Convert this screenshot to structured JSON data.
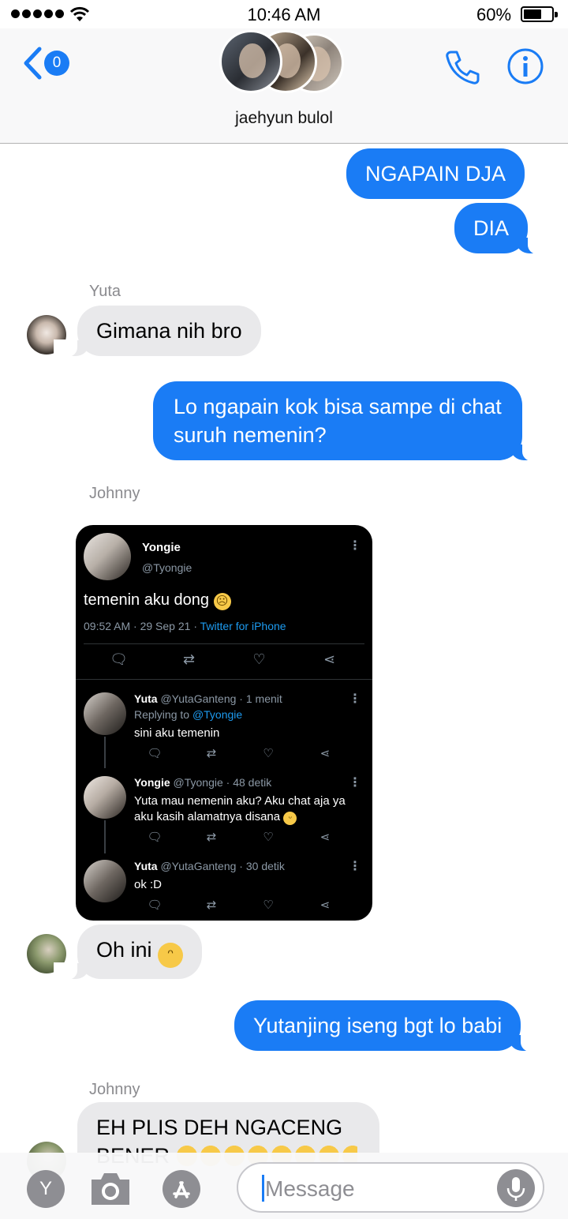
{
  "status_bar": {
    "time": "10:46 AM",
    "battery": "60%"
  },
  "nav": {
    "back_badge": "0",
    "title": "jaehyun bulol"
  },
  "messages": {
    "out1": "NGAPAIN DJA",
    "out2": "DIA",
    "yuta_sender": "Yuta",
    "yuta_msg": "Gimana nih bro",
    "out3_line1": "Lo ngapain kok bisa sampe di chat",
    "out3_line2": "suruh nemenin?",
    "johnny_sender": "Johnny",
    "johnny_msg": "Oh ini",
    "out4": "Yutanjing iseng bgt lo babi",
    "johnny_sender2": "Johnny",
    "johnny_msg2_line1": "EH PLIS DEH NGACENG",
    "johnny_msg2_line2": "BENER"
  },
  "tweet": {
    "name": "Yongie",
    "handle": "@Tyongie",
    "text": "temenin aku dong",
    "meta": "09:52 AM · 29 Sep 21 · ",
    "source": "Twitter for iPhone",
    "replies": [
      {
        "name": "Yuta",
        "handle_time": "@YutaGanteng · 1 menit",
        "replying": "Replying to ",
        "replying_to": "@Tyongie",
        "text": "sini aku temenin"
      },
      {
        "name": "Yongie",
        "handle_time": "@Tyongie · 48 detik",
        "text1": "Yuta mau nemenin aku? Aku chat aja ya",
        "text2": "aku kasih alamatnya disana"
      },
      {
        "name": "Yuta",
        "handle_time": "@YutaGanteng · 30 detik",
        "text": "ok :D"
      }
    ]
  },
  "input": {
    "placeholder": "Message",
    "app_store_letter": "Y"
  },
  "colors": {
    "accent": "#1a7cf5",
    "incoming": "#e9e9eb",
    "secondary_text": "#8a8a8e"
  }
}
